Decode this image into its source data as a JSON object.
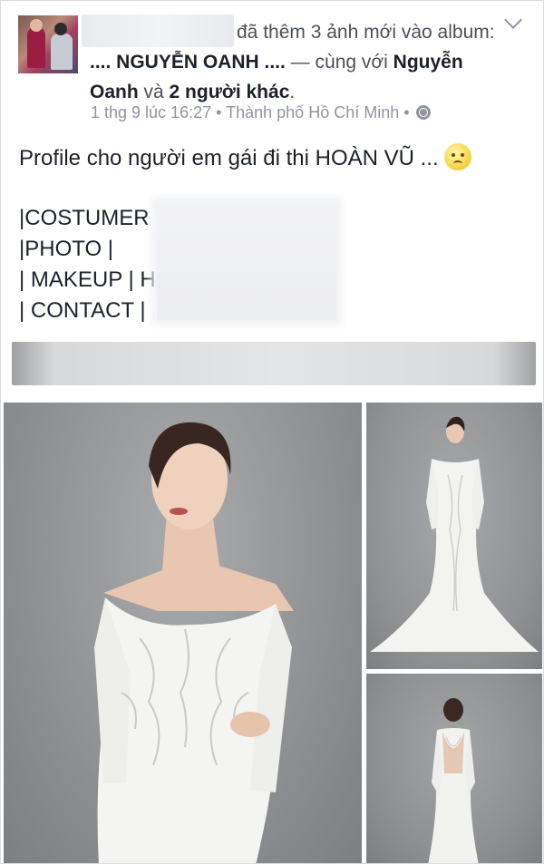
{
  "post": {
    "header": {
      "action_text": "đã thêm 3 ảnh mới vào album: ",
      "album_name": ".... NGUYỄN OANH ....",
      "with_text": " — cùng với ",
      "tagged_name": "Nguyễn Oanh",
      "and_text": " và ",
      "others_text": "2 người khác",
      "end": "."
    },
    "meta": {
      "date": "1 thg 9 lúc 16:27",
      "separator": "•",
      "location": "Thành phố Hồ Chí Minh",
      "separator2": "•"
    },
    "status_text": "Profile cho người em gái đi thi HOÀN VŨ ...",
    "credits": [
      "|COSTUMER",
      "|PHOTO |",
      "| MAKEUP | H",
      "| CONTACT |"
    ]
  },
  "icons": {
    "privacy": "globe-icon",
    "options": "chevron-down-icon",
    "emoji": "frowning-face-icon"
  },
  "colors": {
    "link_text": "#1d2129",
    "meta_text": "#90949c",
    "header_text": "#4b4f56"
  }
}
